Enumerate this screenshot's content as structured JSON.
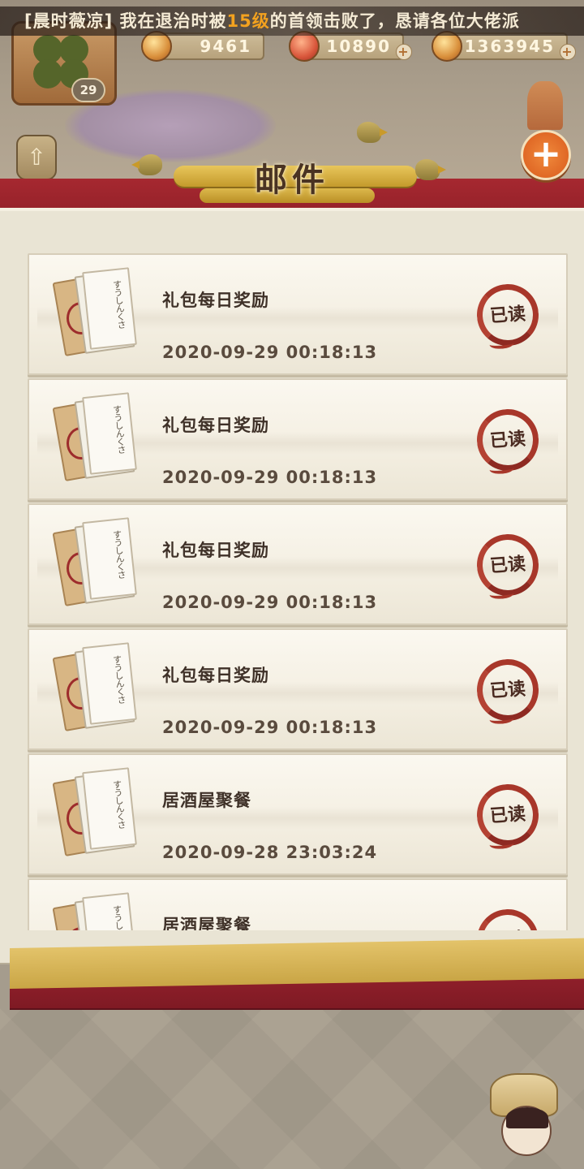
{
  "header": {
    "marquee_prefix": "[晨时薇凉] 我在退治时被",
    "marquee_highlight": "15级",
    "marquee_suffix": "的首领击败了，恳请各位大佬派",
    "player_level": "29",
    "currencies": [
      {
        "name": "coin-icon",
        "value": "9461"
      },
      {
        "name": "fish-icon",
        "value": "10890"
      },
      {
        "name": "copper-coin-icon",
        "value": "1363945"
      }
    ],
    "add_symbol": "+"
  },
  "page_title": "邮件",
  "mails": [
    {
      "title": "礼包每日奖励",
      "time": "2020-09-29 00:18:13",
      "status": "已读"
    },
    {
      "title": "礼包每日奖励",
      "time": "2020-09-29 00:18:13",
      "status": "已读"
    },
    {
      "title": "礼包每日奖励",
      "time": "2020-09-29 00:18:13",
      "status": "已读"
    },
    {
      "title": "礼包每日奖励",
      "time": "2020-09-29 00:18:13",
      "status": "已读"
    },
    {
      "title": "居酒屋聚餐",
      "time": "2020-09-28 23:03:24",
      "status": "已读"
    },
    {
      "title": "居酒屋聚餐",
      "time": "",
      "status": "已读"
    }
  ],
  "colors": {
    "accent_red": "#a62830",
    "stamp_red": "#a8372a",
    "gold": "#d9b646",
    "highlight_orange": "#f3a21f"
  }
}
